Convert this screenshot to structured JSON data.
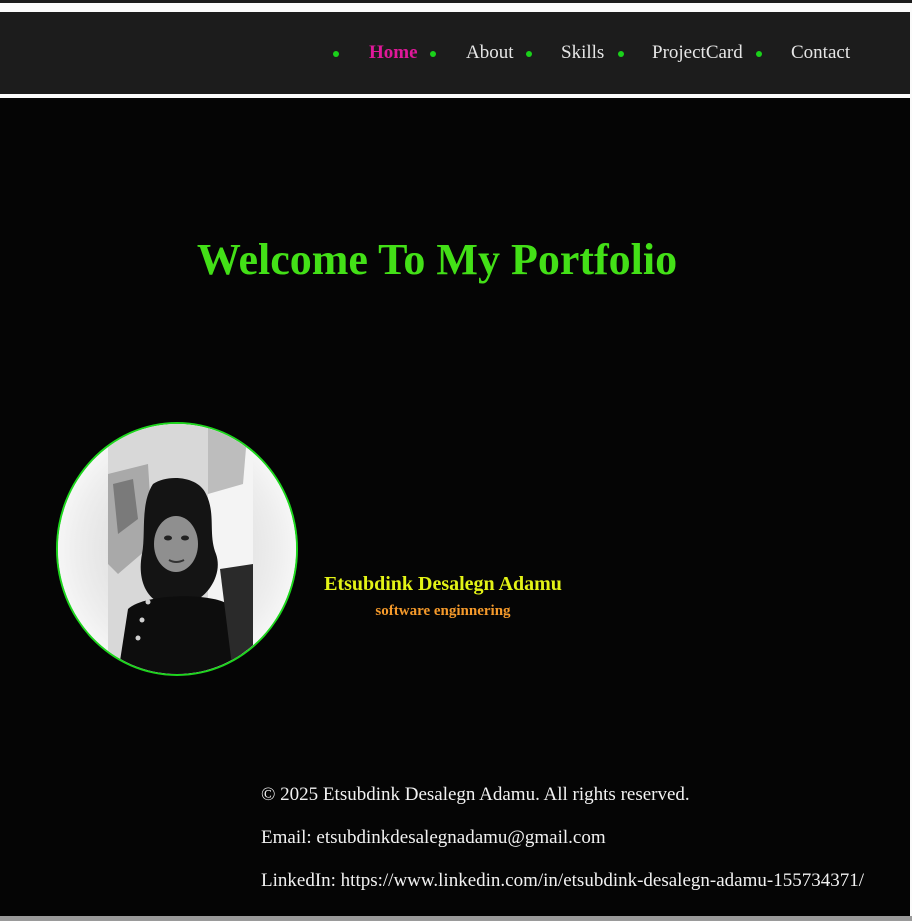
{
  "nav": {
    "items": [
      {
        "label": "Home",
        "active": true
      },
      {
        "label": "About",
        "active": false
      },
      {
        "label": "Skills",
        "active": false
      },
      {
        "label": "ProjectCard",
        "active": false
      },
      {
        "label": "Contact",
        "active": false
      }
    ]
  },
  "hero": {
    "title": "Welcome To My Portfolio"
  },
  "profile": {
    "name": "Etsubdink Desalegn Adamu",
    "role": "software enginnering"
  },
  "footer": {
    "copyright": "© 2025 Etsubdink Desalegn Adamu. All rights reserved.",
    "email": "Email: etsubdinkdesalegnadamu@gmail.com",
    "linkedin": "LinkedIn: https://www.linkedin.com/in/etsubdink-desalegn-adamu-155734371/"
  },
  "colors": {
    "nav_background": "#1c1c1c",
    "page_background": "#050505",
    "active_link": "#e0189a",
    "bullet": "#1ad11a",
    "title": "#43e017",
    "name": "#e3f316",
    "role": "#f59a2b",
    "avatar_border": "#1ed61e"
  }
}
